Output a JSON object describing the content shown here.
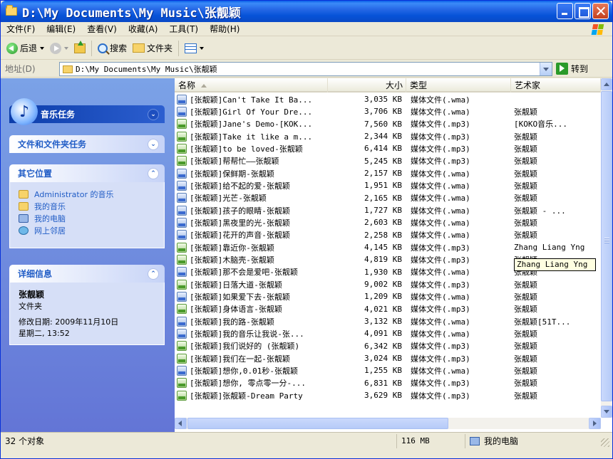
{
  "window": {
    "title": "D:\\My Documents\\My Music\\张靓颖"
  },
  "menu": [
    "文件(F)",
    "编辑(E)",
    "查看(V)",
    "收藏(A)",
    "工具(T)",
    "帮助(H)"
  ],
  "toolbar": {
    "back": "后退",
    "search": "搜索",
    "folders": "文件夹"
  },
  "address": {
    "label": "地址(D)",
    "path": "D:\\My Documents\\My Music\\张靓颖",
    "go": "转到"
  },
  "taskpane": {
    "music_tasks": "音乐任务",
    "file_folder_tasks": "文件和文件夹任务",
    "other_places": {
      "title": "其它位置",
      "items": [
        "Administrator 的音乐",
        "我的音乐",
        "我的电脑",
        "网上邻居"
      ]
    },
    "details": {
      "title": "详细信息",
      "name": "张靓颖",
      "kind": "文件夹",
      "modified": "修改日期: 2009年11月10日",
      "weekday_time": "星期二, 13:52"
    }
  },
  "columns": {
    "name": "名称",
    "size": "大小",
    "type": "类型",
    "artist": "艺术家"
  },
  "files": [
    {
      "name": "[张靓颖]Can't Take It Ba...",
      "size": "3,035 KB",
      "type": "媒体文件(.wma)",
      "artist": "",
      "kind": "wma"
    },
    {
      "name": "[张靓颖]Girl Of Your Dre...",
      "size": "3,706 KB",
      "type": "媒体文件(.wma)",
      "artist": "张靓颖",
      "kind": "wma"
    },
    {
      "name": "[张靓颖]Jane's Demo-[KOK...",
      "size": "7,560 KB",
      "type": "媒体文件(.mp3)",
      "artist": "[KOKO音乐...",
      "kind": "mp3"
    },
    {
      "name": "[张靓颖]Take it like a m...",
      "size": "2,344 KB",
      "type": "媒体文件(.mp3)",
      "artist": "张靓颖",
      "kind": "mp3"
    },
    {
      "name": "[张靓颖]to be loved-张靓颖",
      "size": "6,414 KB",
      "type": "媒体文件(.mp3)",
      "artist": "张靓颖",
      "kind": "mp3"
    },
    {
      "name": "[张靓颖]帮帮忙——张靓颖",
      "size": "5,245 KB",
      "type": "媒体文件(.mp3)",
      "artist": "张靓颖",
      "kind": "mp3"
    },
    {
      "name": "[张靓颖]保鲜期-张靓颖",
      "size": "2,157 KB",
      "type": "媒体文件(.wma)",
      "artist": "张靓颖",
      "kind": "wma"
    },
    {
      "name": "[张靓颖]给不起的爱-张靓颖",
      "size": "1,951 KB",
      "type": "媒体文件(.wma)",
      "artist": "张靓颖",
      "kind": "wma"
    },
    {
      "name": "[张靓颖]光芒-张靓颖",
      "size": "2,165 KB",
      "type": "媒体文件(.wma)",
      "artist": "张靓颖",
      "kind": "wma"
    },
    {
      "name": "[张靓颖]孩子的眼睛-张靓颖",
      "size": "1,727 KB",
      "type": "媒体文件(.wma)",
      "artist": "张靓颖 - ...",
      "kind": "wma"
    },
    {
      "name": "[张靓颖]黑夜里的光-张靓颖",
      "size": "2,603 KB",
      "type": "媒体文件(.wma)",
      "artist": "张靓颖",
      "kind": "wma"
    },
    {
      "name": "[张靓颖]花开的声音-张靓颖",
      "size": "2,258 KB",
      "type": "媒体文件(.wma)",
      "artist": "张靓颖",
      "kind": "wma"
    },
    {
      "name": "[张靓颖]靠近你-张靓颖",
      "size": "4,145 KB",
      "type": "媒体文件(.mp3)",
      "artist": "Zhang Liang Yng",
      "kind": "mp3"
    },
    {
      "name": "[张靓颖]木脑壳-张靓颖",
      "size": "4,819 KB",
      "type": "媒体文件(.mp3)",
      "artist": "张靓颖",
      "kind": "mp3"
    },
    {
      "name": "[张靓颖]那不会是爱吧-张靓颖",
      "size": "1,930 KB",
      "type": "媒体文件(.wma)",
      "artist": "张靓颖",
      "kind": "wma"
    },
    {
      "name": "[张靓颖]日落大道-张靓颖",
      "size": "9,002 KB",
      "type": "媒体文件(.mp3)",
      "artist": "张靓颖",
      "kind": "mp3"
    },
    {
      "name": "[张靓颖]如果爱下去-张靓颖",
      "size": "1,209 KB",
      "type": "媒体文件(.wma)",
      "artist": "张靓颖",
      "kind": "wma"
    },
    {
      "name": "[张靓颖]身体语言-张靓颖",
      "size": "4,021 KB",
      "type": "媒体文件(.mp3)",
      "artist": "张靓颖",
      "kind": "mp3"
    },
    {
      "name": "[张靓颖]我的路-张靓颖",
      "size": "3,132 KB",
      "type": "媒体文件(.wma)",
      "artist": "张靓颖[51T...",
      "kind": "wma"
    },
    {
      "name": "[张靓颖]我的音乐让我说-张...",
      "size": "4,091 KB",
      "type": "媒体文件(.wma)",
      "artist": "张靓颖",
      "kind": "wma"
    },
    {
      "name": "[张靓颖]我们说好的  (张靓颖)",
      "size": "6,342 KB",
      "type": "媒体文件(.mp3)",
      "artist": "张靓颖",
      "kind": "mp3"
    },
    {
      "name": "[张靓颖]我们在一起-张靓颖",
      "size": "3,024 KB",
      "type": "媒体文件(.mp3)",
      "artist": "张靓颖",
      "kind": "mp3"
    },
    {
      "name": "[张靓颖]想你,0.01秒-张靓颖",
      "size": "1,255 KB",
      "type": "媒体文件(.wma)",
      "artist": "张靓颖",
      "kind": "wma"
    },
    {
      "name": "[张靓颖]想你, 零点零一分-...",
      "size": "6,831 KB",
      "type": "媒体文件(.mp3)",
      "artist": "张靓颖",
      "kind": "mp3"
    },
    {
      "name": "[张靓颖]张靓颖-Dream Party",
      "size": "3,629 KB",
      "type": "媒体文件(.mp3)",
      "artist": "张靓颖",
      "kind": "mp3"
    }
  ],
  "tooltip": "Zhang Liang Yng",
  "status": {
    "count": "32 个对象",
    "size": "116 MB",
    "zone": "我的电脑"
  }
}
